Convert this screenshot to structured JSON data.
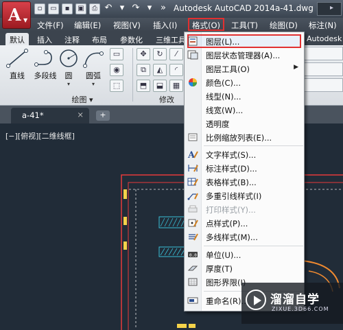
{
  "titlebar": {
    "app_title": "Autodesk AutoCAD 2014",
    "file_name": "a-41.dwg",
    "search_hint": "▸"
  },
  "menubar": {
    "items": [
      "文件(F)",
      "编辑(E)",
      "视图(V)",
      "插入(I)",
      "格式(O)",
      "工具(T)",
      "绘图(D)",
      "标注(N)"
    ]
  },
  "ribbon_tabs": {
    "items": [
      "默认",
      "插入",
      "注释",
      "布局",
      "参数化",
      "三维工具"
    ],
    "right_label": "Autodesk"
  },
  "ribbon": {
    "tools": {
      "line": "直线",
      "polyline": "多段线",
      "circle": "圆",
      "arc": "圆弧"
    },
    "panel_draw": "绘图 ▾",
    "panel_modify": "修改"
  },
  "filetab": {
    "name": "a-41*",
    "close": "×",
    "new": "+"
  },
  "viewport": {
    "label": "[−][俯视][二维线框]"
  },
  "dropdown": {
    "items": [
      {
        "label": "图层(L)...",
        "icon": "layer-icon"
      },
      {
        "label": "图层状态管理器(A)...",
        "icon": "layer-state-icon"
      },
      {
        "label": "图层工具(O)",
        "icon": "",
        "submenu": "▶"
      },
      {
        "label": "颜色(C)...",
        "icon": "color-wheel-icon"
      },
      {
        "label": "线型(N)...",
        "icon": ""
      },
      {
        "label": "线宽(W)...",
        "icon": ""
      },
      {
        "label": "透明度",
        "icon": ""
      },
      {
        "label": "比例缩放列表(E)...",
        "icon": "scale-list-icon"
      },
      {
        "label": "文字样式(S)...",
        "icon": "text-style-icon"
      },
      {
        "label": "标注样式(D)...",
        "icon": "dim-style-icon"
      },
      {
        "label": "表格样式(B)...",
        "icon": "table-style-icon"
      },
      {
        "label": "多重引线样式(I)",
        "icon": "mleader-style-icon"
      },
      {
        "label": "打印样式(Y)...",
        "icon": "plot-style-icon",
        "disabled": true
      },
      {
        "label": "点样式(P)...",
        "icon": "point-style-icon"
      },
      {
        "label": "多线样式(M)...",
        "icon": "mline-style-icon"
      },
      {
        "label": "单位(U)...",
        "icon": "units-icon"
      },
      {
        "label": "厚度(T)",
        "icon": "thickness-icon"
      },
      {
        "label": "图形界限(I)",
        "icon": "limits-icon"
      },
      {
        "label": "重命名(R)...",
        "icon": "rename-icon"
      }
    ]
  },
  "watermark": {
    "title": "溜溜自学",
    "url": "ZIXUE.3D66.COM"
  },
  "colors": {
    "highlight_red": "#e23030",
    "canvas_bg": "#212c38",
    "accent_app": "#c0262e"
  }
}
